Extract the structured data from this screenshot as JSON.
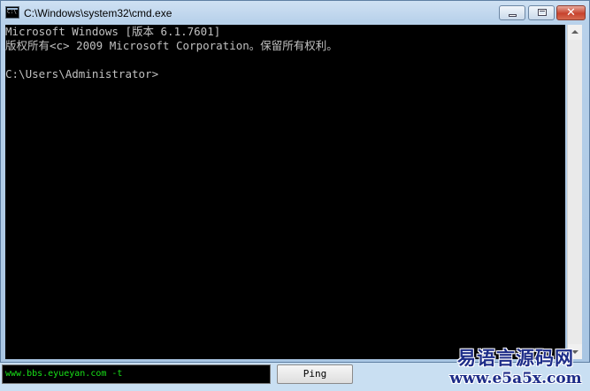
{
  "window": {
    "title": "C:\\Windows\\system32\\cmd.exe",
    "close_glyph": "✕"
  },
  "console": {
    "lines": [
      "Microsoft Windows [版本 6.1.7601]",
      "版权所有<c> 2009 Microsoft Corporation。保留所有权利。",
      "",
      "C:\\Users\\Administrator>"
    ],
    "background": "#000000",
    "text_color": "#c0c0c0"
  },
  "controls": {
    "command_value": "www.bbs.eyueyan.com -t",
    "ping_label": "Ping"
  },
  "watermark": {
    "line1": "易语言源码网",
    "line2": "www.e5a5x.com"
  },
  "icons": {
    "app": "cmd-icon",
    "minimize": "minimize-icon",
    "maximize": "maximize-icon",
    "close": "close-icon"
  }
}
